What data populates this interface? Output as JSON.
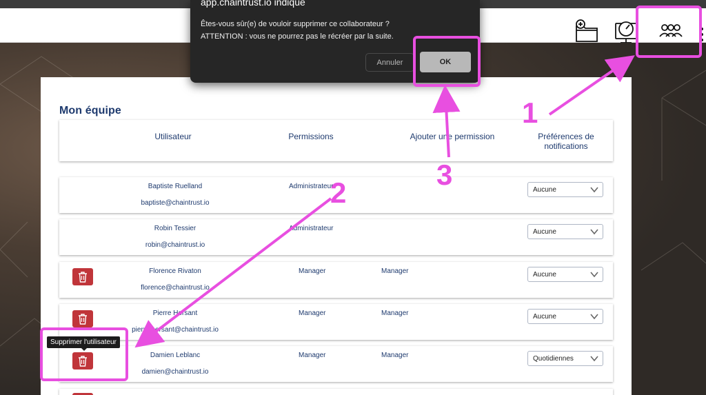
{
  "header": {
    "icons": [
      {
        "name": "add-folder-icon"
      },
      {
        "name": "dashboard-gauge-icon"
      },
      {
        "name": "team-icon"
      }
    ]
  },
  "dialog": {
    "origin": "app.chaintrust.io indique",
    "message_line1": "Êtes-vous sûr(e) de vouloir supprimer ce collaborateur ?",
    "message_line2": "ATTENTION : vous ne pourrez pas le récréer par la suite.",
    "cancel_label": "Annuler",
    "ok_label": "OK"
  },
  "team": {
    "title": "Mon équipe",
    "columns": {
      "user": "Utilisateur",
      "permissions": "Permissions",
      "add_permission": "Ajouter une permission",
      "notif_line1": "Préférences de",
      "notif_line2": "notifications"
    },
    "rows": [
      {
        "name": "Baptiste Ruelland",
        "email": "baptiste@chaintrust.io",
        "permission": "Administrateur",
        "added": "",
        "notif": "Aucune"
      },
      {
        "name": "Robin Tessier",
        "email": "robin@chaintrust.io",
        "permission": "Administrateur",
        "added": "",
        "notif": "Aucune"
      },
      {
        "name": "Florence Rivaton",
        "email": "florence@chaintrust.io",
        "permission": "Manager",
        "added": "Manager",
        "notif": "Aucune"
      },
      {
        "name": "Pierre Hersant",
        "email": "pierre.hersant@chaintrust.io",
        "permission": "Manager",
        "added": "Manager",
        "notif": "Aucune"
      },
      {
        "name": "Damien Leblanc",
        "email": "damien@chaintrust.io",
        "permission": "Manager",
        "added": "Manager",
        "notif": "Quotidiennes"
      }
    ],
    "delete_tooltip": "Supprimer l'utilisateur"
  },
  "annotations": {
    "step1": "1",
    "step2": "2",
    "step3": "3",
    "color": "#e84fe0"
  },
  "colors": {
    "accent_text": "#1e3a6e",
    "delete_button": "#c0353a",
    "dialog_bg": "#262626"
  }
}
